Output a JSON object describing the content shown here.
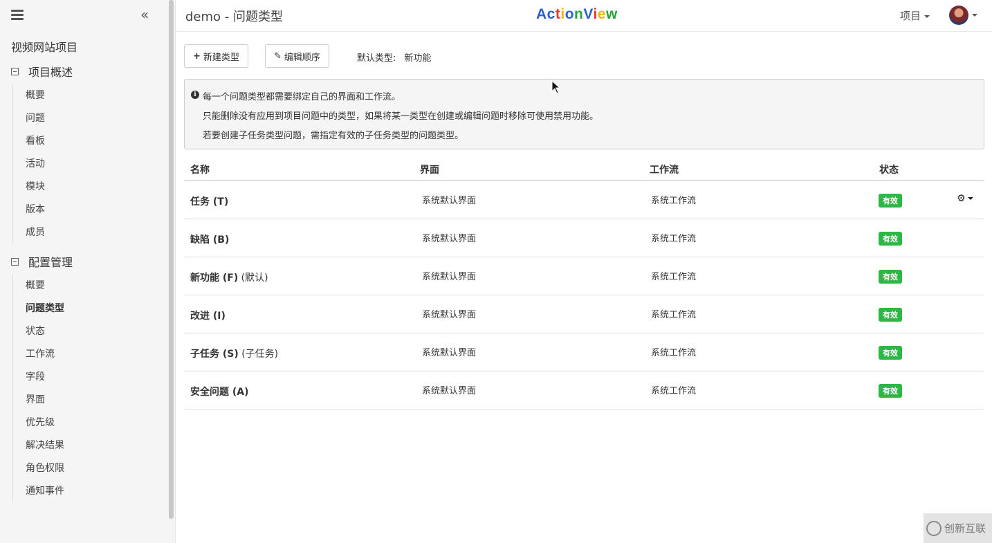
{
  "sidebar": {
    "project_name": "视频网站项目",
    "groups": [
      {
        "title": "项目概述",
        "items": [
          "概要",
          "问题",
          "看板",
          "活动",
          "模块",
          "版本",
          "成员"
        ]
      },
      {
        "title": "配置管理",
        "items": [
          "概要",
          "问题类型",
          "状态",
          "工作流",
          "字段",
          "界面",
          "优先级",
          "解决结果",
          "角色权限",
          "通知事件"
        ]
      }
    ],
    "active_item": "问题类型"
  },
  "topbar": {
    "title": "demo - 问题类型",
    "logo": [
      "A",
      "c",
      "t",
      "i",
      "o",
      "n",
      "V",
      "i",
      "e",
      "w"
    ],
    "logo_colors": [
      "#2a62c9",
      "#2a62c9",
      "#e23b2e",
      "#f4b400",
      "#2a62c9",
      "#2aa33a",
      "#2a62c9",
      "#e23b2e",
      "#f4b400",
      "#2aa33a"
    ],
    "project_menu": "项目"
  },
  "toolbar": {
    "new_type_icon": "+",
    "new_type_label": "新建类型",
    "edit_order_icon": "✎",
    "edit_order_label": "编辑顺序",
    "default_type_label": "默认类型:",
    "default_type_value": "新功能"
  },
  "info": {
    "lines": [
      "每一个问题类型都需要绑定自己的界面和工作流。",
      "只能删除没有应用到项目问题中的类型，如果将某一类型在创建或编辑问题时移除可使用禁用功能。",
      "若要创建子任务类型问题，需指定有效的子任务类型的问题类型。"
    ]
  },
  "table": {
    "headers": [
      "名称",
      "界面",
      "工作流",
      "状态"
    ],
    "rows": [
      {
        "name": "任务 (T)",
        "suffix": "",
        "screen": "系统默认界面",
        "workflow": "系统工作流",
        "status": "有效"
      },
      {
        "name": "缺陷 (B)",
        "suffix": "",
        "screen": "系统默认界面",
        "workflow": "系统工作流",
        "status": "有效"
      },
      {
        "name": "新功能 (F)",
        "suffix": " (默认)",
        "screen": "系统默认界面",
        "workflow": "系统工作流",
        "status": "有效"
      },
      {
        "name": "改进 (I)",
        "suffix": "",
        "screen": "系统默认界面",
        "workflow": "系统工作流",
        "status": "有效"
      },
      {
        "name": "子任务 (S)",
        "suffix": " (子任务)",
        "screen": "系统默认界面",
        "workflow": "系统工作流",
        "status": "有效"
      },
      {
        "name": "安全问题 (A)",
        "suffix": "",
        "screen": "系统默认界面",
        "workflow": "系统工作流",
        "status": "有效"
      }
    ]
  },
  "watermark": "创新互联",
  "colors": {
    "status_green": "#2db745"
  }
}
